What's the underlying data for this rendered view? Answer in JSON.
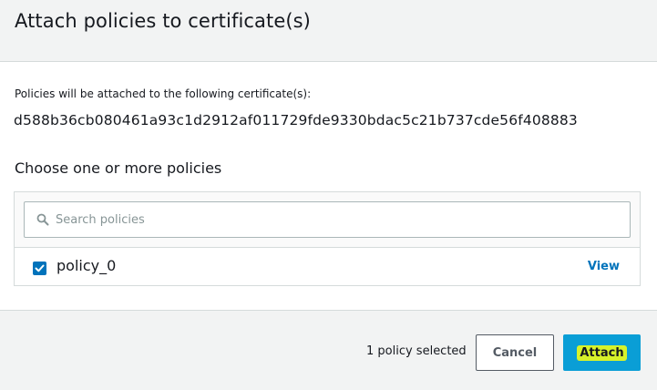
{
  "dialog": {
    "title": "Attach policies to certificate(s)"
  },
  "certificate": {
    "label": "Policies will be attached to the following certificate(s):",
    "id": "d588b36cb080461a93c1d2912af011729fde9330bdac5c21b737cde56f408883"
  },
  "policies": {
    "heading": "Choose one or more policies",
    "search": {
      "placeholder": "Search policies",
      "value": "",
      "icon": "search-icon"
    },
    "items": [
      {
        "name": "policy_0",
        "checked": true,
        "view_label": "View"
      }
    ]
  },
  "footer": {
    "selected_text": "1 policy selected",
    "cancel_label": "Cancel",
    "attach_label": "Attach"
  },
  "colors": {
    "header_bg": "#f2f3f3",
    "primary_button": "#0a9ed6",
    "link": "#0073bb",
    "highlight": "#d7f22a"
  }
}
